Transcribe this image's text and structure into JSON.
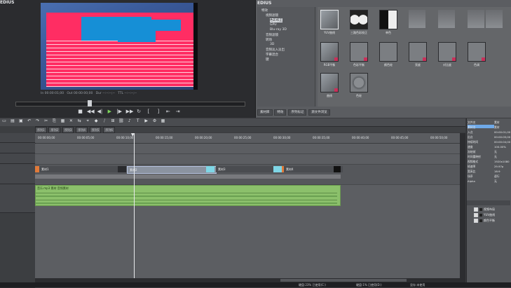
{
  "app": {
    "title": "EDIUS"
  },
  "player": {
    "timecode_in": "In 00:00:01;00",
    "timecode_out": "Out 00:00:00;00",
    "timecode_dur": "Dur --:--:--;--",
    "timecode_ttl": "TTL --:--:--;--"
  },
  "effects_panel": {
    "title": "EDIUS",
    "tree": [
      "特效",
      "视频滤镜",
      "色彩校正",
      "GPU",
      "Blu-ray 3D",
      "音频滤镜",
      "转场",
      "3D",
      "音频淡入淡出",
      "字幕混合",
      "键"
    ],
    "items": [
      {
        "label": "YUV曲线",
        "selected": true,
        "red": false
      },
      {
        "label": "三路色彩校正",
        "selected": false,
        "red": false
      },
      {
        "label": "单色",
        "selected": false,
        "red": false
      },
      {
        "label": "",
        "selected": false,
        "red": false
      },
      {
        "label": "",
        "selected": false,
        "red": false
      },
      {
        "label": "",
        "selected": false,
        "red": false
      },
      {
        "label": "",
        "selected": false,
        "red": false
      },
      {
        "label": "RGB平衡",
        "selected": false,
        "red": true
      },
      {
        "label": "色彩平衡",
        "selected": false,
        "red": true
      },
      {
        "label": "颜色轮",
        "selected": false,
        "red": false
      },
      {
        "label": "亮度",
        "selected": false,
        "red": true
      },
      {
        "label": "对比度",
        "selected": false,
        "red": true
      },
      {
        "label": "色调",
        "selected": false,
        "red": true
      },
      {
        "label": "曲线",
        "selected": false,
        "red": true
      },
      {
        "label": "色轮",
        "selected": false,
        "red": false
      }
    ],
    "tabs": [
      "素材库",
      "特效",
      "序列标记",
      "源文件浏览"
    ]
  },
  "timeline": {
    "sequence_tabs": [
      "序列1",
      "序列2",
      "序列3",
      "序列4",
      "序列5",
      "序列6"
    ],
    "ruler_ticks": [
      "00:00:00;00",
      "00:00:05;00",
      "00:00:10;00",
      "00:00:15;00",
      "00:00:20;00",
      "00:00:25;00",
      "00:00:30;00",
      "00:00:35;00",
      "00:00:40;00",
      "00:00:45;00",
      "00:00:50;00"
    ],
    "clips": [
      {
        "label": "素材1"
      },
      {
        "label": "素材2"
      },
      {
        "label": "素材3"
      },
      {
        "label": "素材4"
      }
    ],
    "audio_clip_label": "音乐.mp3 素材 音频素材"
  },
  "info_panel": {
    "rows": [
      {
        "k": "文件名",
        "v": "素材"
      },
      {
        "k": "素材名",
        "v": "素材"
      },
      {
        "k": "入点",
        "v": "00:00:01;00"
      },
      {
        "k": "出点",
        "v": "00:00:05;00"
      },
      {
        "k": "持续时间",
        "v": "00:00:04;00"
      },
      {
        "k": "速度",
        "v": "100.00%"
      },
      {
        "k": "冻结帧",
        "v": "无"
      },
      {
        "k": "时间重映射",
        "v": "无"
      },
      {
        "k": "视频格式",
        "v": "1920x1080"
      },
      {
        "k": "帧速率",
        "v": "29.97p"
      },
      {
        "k": "宽高比",
        "v": "16:9"
      },
      {
        "k": "场序",
        "v": "逐行"
      },
      {
        "k": "Alpha",
        "v": "无"
      }
    ],
    "layers": [
      "视频布局",
      "YUV曲线",
      "颜色平衡"
    ]
  },
  "status": {
    "items": [
      "硬盘:23% 已使用(C:)",
      "硬盘:1% 已使用(D:)",
      "显存:未使用"
    ]
  },
  "colors": {
    "accent": "#6fa9e8",
    "video_clip": "#8bc06b"
  }
}
